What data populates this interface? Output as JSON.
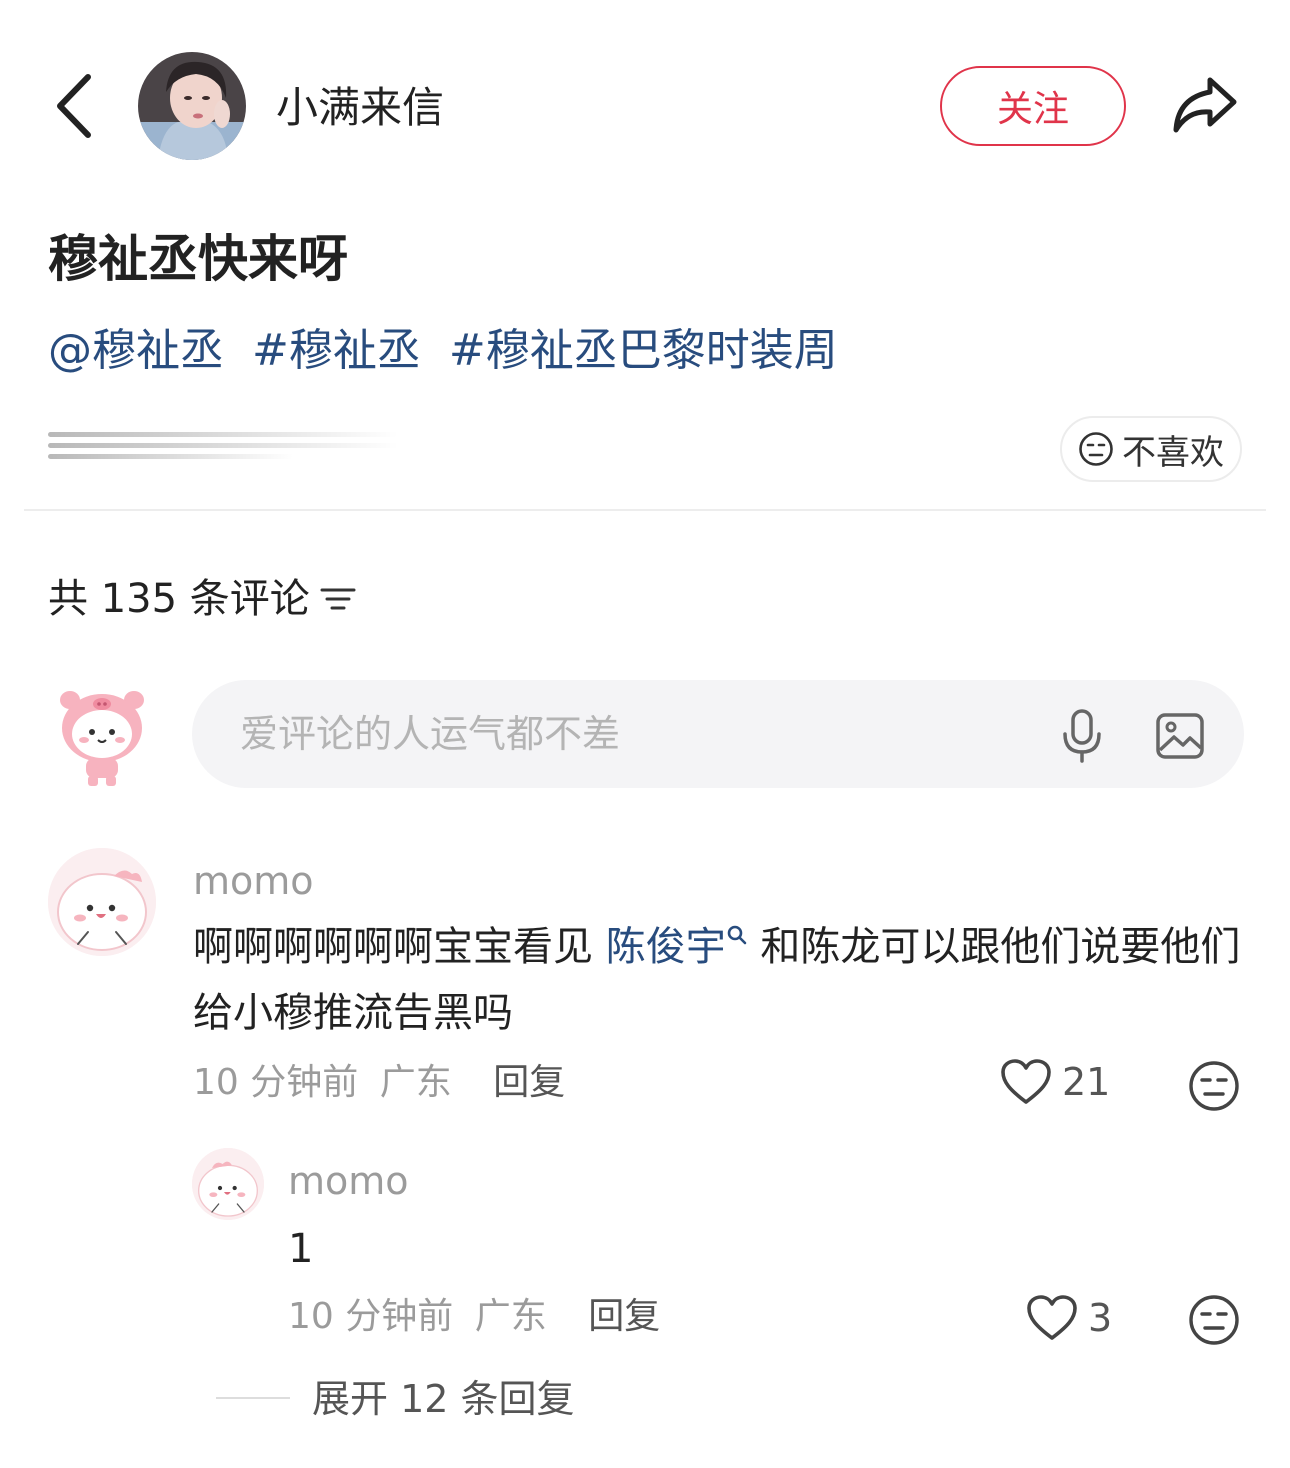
{
  "header": {
    "author_name": "小满来信",
    "follow_label": "关注"
  },
  "note": {
    "title": "穆祉丞快来呀",
    "tags": [
      "@穆祉丞",
      "#穆祉丞",
      "#穆祉丞巴黎时装周"
    ],
    "dislike_label": "不喜欢"
  },
  "comments_section": {
    "count_label": "共 135 条评论",
    "input_placeholder": "爱评论的人运气都不差"
  },
  "comments": [
    {
      "user": "momo",
      "text_before": "啊啊啊啊啊啊宝宝看见 ",
      "mention": "陈俊宇",
      "text_after": " 和陈龙可以跟他们说要他们给小穆推流告黑吗",
      "time": "10 分钟前",
      "location": "广东",
      "reply_label": "回复",
      "likes": "21"
    }
  ],
  "replies": [
    {
      "user": "momo",
      "text": "1",
      "time": "10 分钟前",
      "location": "广东",
      "reply_label": "回复",
      "likes": "3"
    }
  ],
  "expand_label": "展开 12 条回复",
  "colors": {
    "accent": "#e0344a",
    "link": "#284c7e",
    "muted": "#9b9b9b"
  }
}
